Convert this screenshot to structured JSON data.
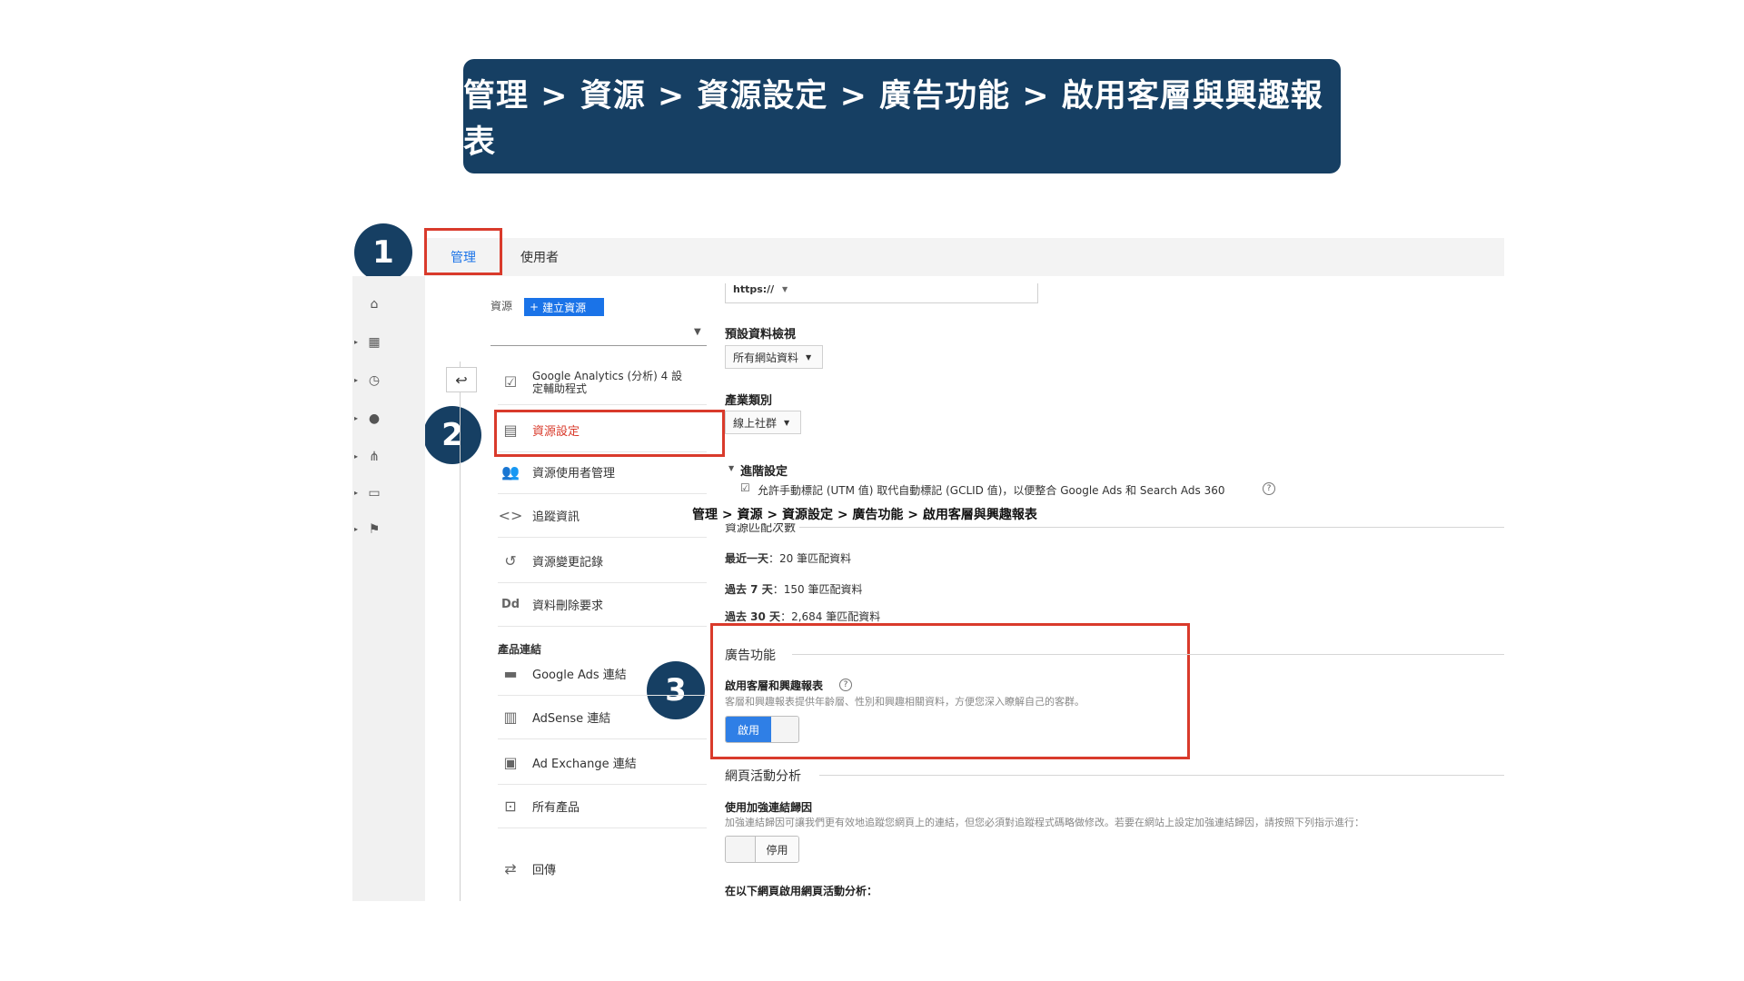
{
  "banner": {
    "title": "管理 > 資源 > 資源設定 > 廣告功能 > 啟用客層與興趣報表"
  },
  "tabs": {
    "admin": "管理",
    "users": "使用者"
  },
  "steps": [
    "1",
    "2",
    "3"
  ],
  "left_panel": {
    "resource_label": "資源",
    "create_button": "建立資源",
    "menu": [
      {
        "icon": "checkbox-icon",
        "label": "Google Analytics (分析) 4 設定輔助程式"
      },
      {
        "icon": "window-icon",
        "label": "資源設定"
      },
      {
        "icon": "people-icon",
        "label": "資源使用者管理"
      },
      {
        "icon": "code-icon",
        "label": "追蹤資訊"
      },
      {
        "icon": "history-icon",
        "label": "資源變更記錄"
      },
      {
        "icon": "dd-icon",
        "label": "資料刪除要求"
      }
    ],
    "product_links_heading": "產品連結",
    "product_links": [
      {
        "icon": "ads-icon",
        "label": "Google Ads 連結"
      },
      {
        "icon": "adsense-icon",
        "label": "AdSense 連結"
      },
      {
        "icon": "adexchange-icon",
        "label": "Ad Exchange 連結"
      },
      {
        "icon": "allproducts-icon",
        "label": "所有產品"
      }
    ],
    "postback": "回傳"
  },
  "settings": {
    "url_prefix": "https://",
    "default_view_label": "預設資料檢視",
    "default_view_value": "所有網站資料",
    "industry_label": "產業類別",
    "industry_value": "線上社群",
    "advanced_label": "進階設定",
    "advanced_checkbox": "允許手動標記 (UTM 值) 取代自動標記 (GCLID 值)，以便整合 Google Ads 和 Search Ads 360",
    "caption_overlay": "管理 > 資源 > 資源設定 > 廣告功能 > 啟用客層與興趣報表",
    "match_count_label": "資源匹配次數",
    "last_day_label": "最近一天",
    "last_day_value": "：20 筆匹配資料",
    "last7_label": "過去 7 天",
    "last7_value": "：150 筆匹配資料",
    "last30_label": "過去 30 天",
    "last30_value": "：2,684 筆匹配資料",
    "ad_features_heading": "廣告功能",
    "demographics_label": "啟用客層和興趣報表",
    "demographics_desc": "客層和興趣報表提供年齡層、性別和興趣相關資料，方便您深入瞭解自己的客群。",
    "demographics_toggle": "啟用",
    "page_analytics_heading": "網頁活動分析",
    "enhanced_link_label": "使用加強連結歸因",
    "enhanced_link_desc": "加強連結歸因可讓我們更有效地追蹤您網頁上的連結，但您必須對追蹤程式碼略做修改。若要在網站上設定加強連結歸因，請按照下列指示進行：",
    "enhanced_link_toggle": "停用",
    "page_analytics_enable_label": "在以下網頁啟用網頁活動分析："
  }
}
